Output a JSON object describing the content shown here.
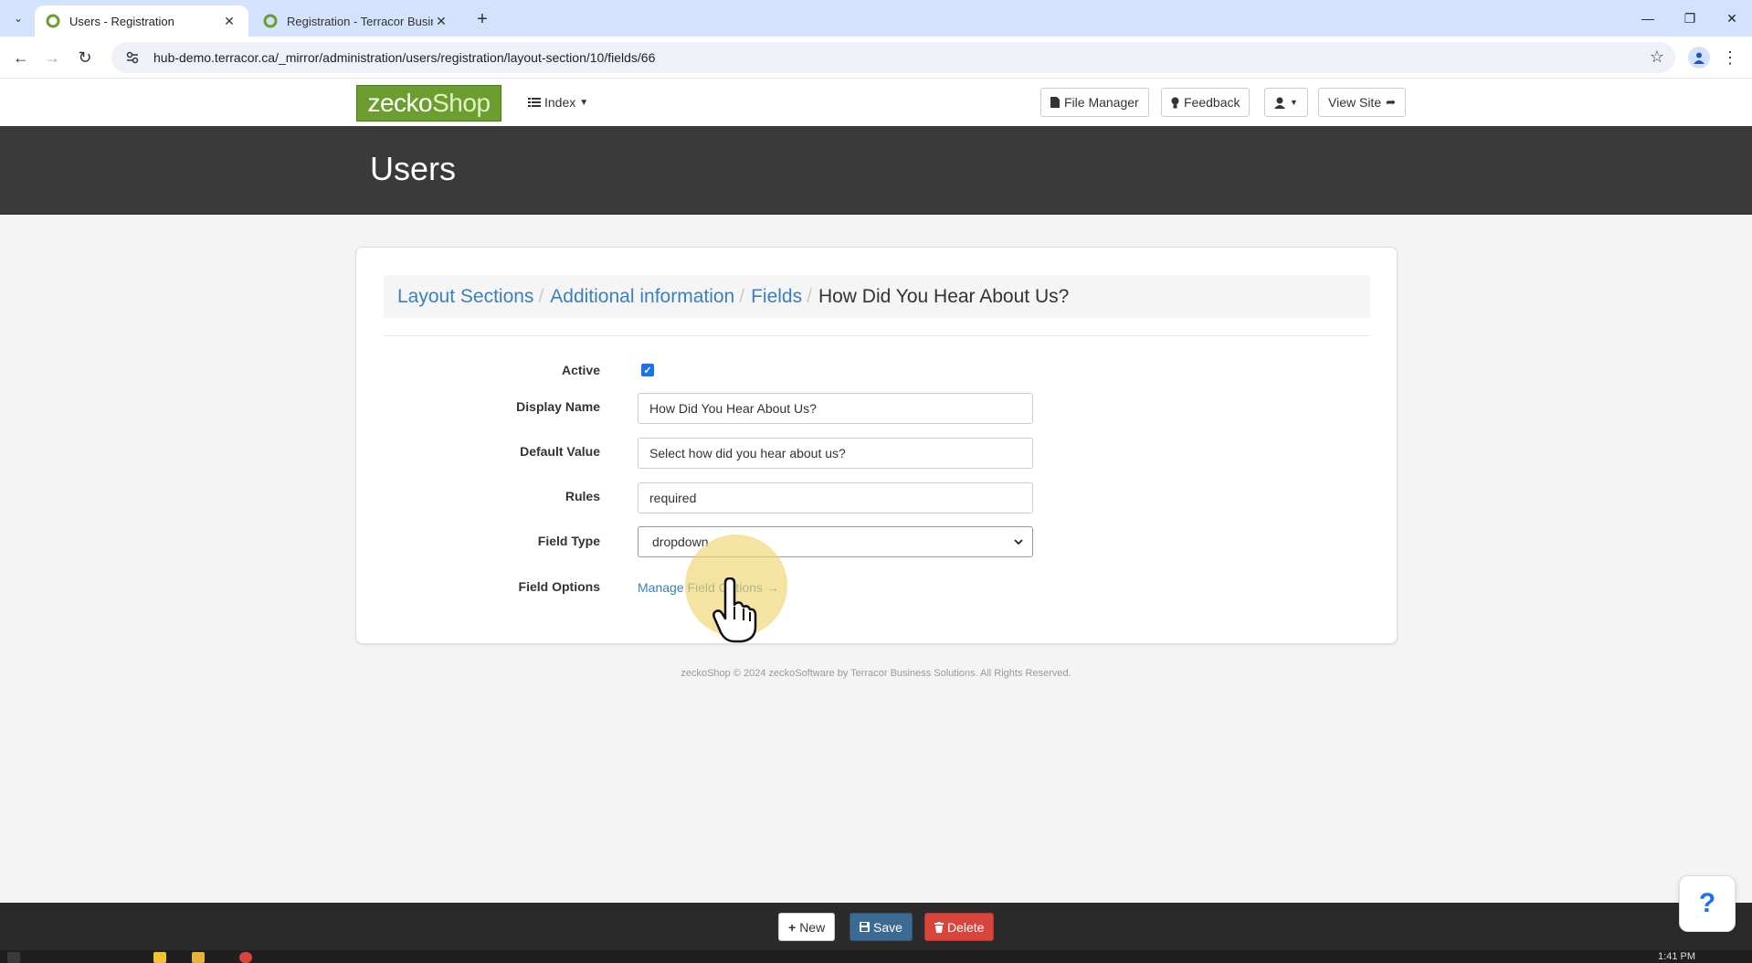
{
  "browser": {
    "tabs": [
      {
        "title": "Users - Registration",
        "active": true
      },
      {
        "title": "Registration - Terracor Business Solutions",
        "active": false
      }
    ],
    "url": "hub-demo.terracor.ca/_mirror/administration/users/registration/layout-section/10/fields/66"
  },
  "header": {
    "logo_part1": "zecko",
    "logo_part2": "Shop",
    "index_label": "Index",
    "file_manager_label": "File Manager",
    "feedback_label": "Feedback",
    "view_site_label": "View Site"
  },
  "banner": {
    "title": "Users"
  },
  "breadcrumb": {
    "items": [
      "Layout Sections",
      "Additional information",
      "Fields"
    ],
    "current": "How Did You Hear About Us?"
  },
  "form": {
    "active_label": "Active",
    "active_checked": true,
    "display_name_label": "Display Name",
    "display_name_value": "How Did You Hear About Us?",
    "default_value_label": "Default Value",
    "default_value_value": "Select how did you hear about us?",
    "rules_label": "Rules",
    "rules_value": "required",
    "field_type_label": "Field Type",
    "field_type_value": "dropdown",
    "field_options_label": "Field Options",
    "field_options_link": "Manage Field Options →"
  },
  "footer": {
    "text": "zeckoShop © 2024 zeckoSoftware by Terracor Business Solutions. All Rights Reserved."
  },
  "actions": {
    "new_label": "New",
    "save_label": "Save",
    "delete_label": "Delete"
  },
  "help": {
    "label": "?"
  },
  "taskbar": {
    "clock": "1:41 PM"
  },
  "colors": {
    "brand": "#6b9e2e",
    "link": "#3a7fbf",
    "banner": "#3a3a3a",
    "save": "#3d6a93",
    "delete": "#d9453d"
  }
}
